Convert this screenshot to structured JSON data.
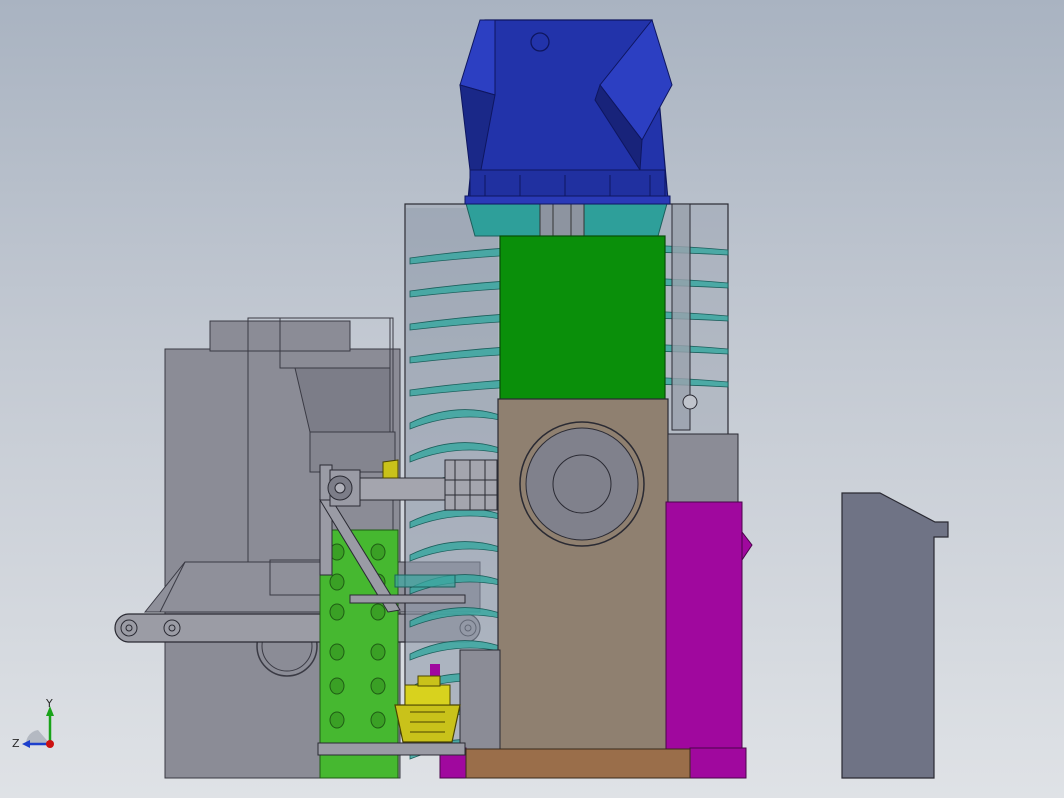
{
  "viewport": {
    "background_top": "#a9b3c1",
    "background_bottom": "#dfe2e6"
  },
  "model": {
    "parts": [
      {
        "name": "motor-housing",
        "color": "#2233aa"
      },
      {
        "name": "motor-flange",
        "color": "#2e9f9a"
      },
      {
        "name": "spiral-screw",
        "color": "#3aa7a0"
      },
      {
        "name": "green-panel",
        "color": "#0a8f0a"
      },
      {
        "name": "tan-gearbox",
        "color": "#8f8070"
      },
      {
        "name": "magenta-panel",
        "color": "#a0089e"
      },
      {
        "name": "grey-base-frame",
        "color": "#8b8c96"
      },
      {
        "name": "yellow-component",
        "color": "#c9c21a"
      },
      {
        "name": "bronze-base-plate",
        "color": "#9a6e4a"
      },
      {
        "name": "separate-grey-block",
        "color": "#6f7385"
      }
    ]
  },
  "triad": {
    "x_label": "",
    "y_label": "Y",
    "z_label": "Z",
    "y_color": "#19a319",
    "z_color": "#1d3fcc",
    "origin_color": "#cc1111"
  }
}
